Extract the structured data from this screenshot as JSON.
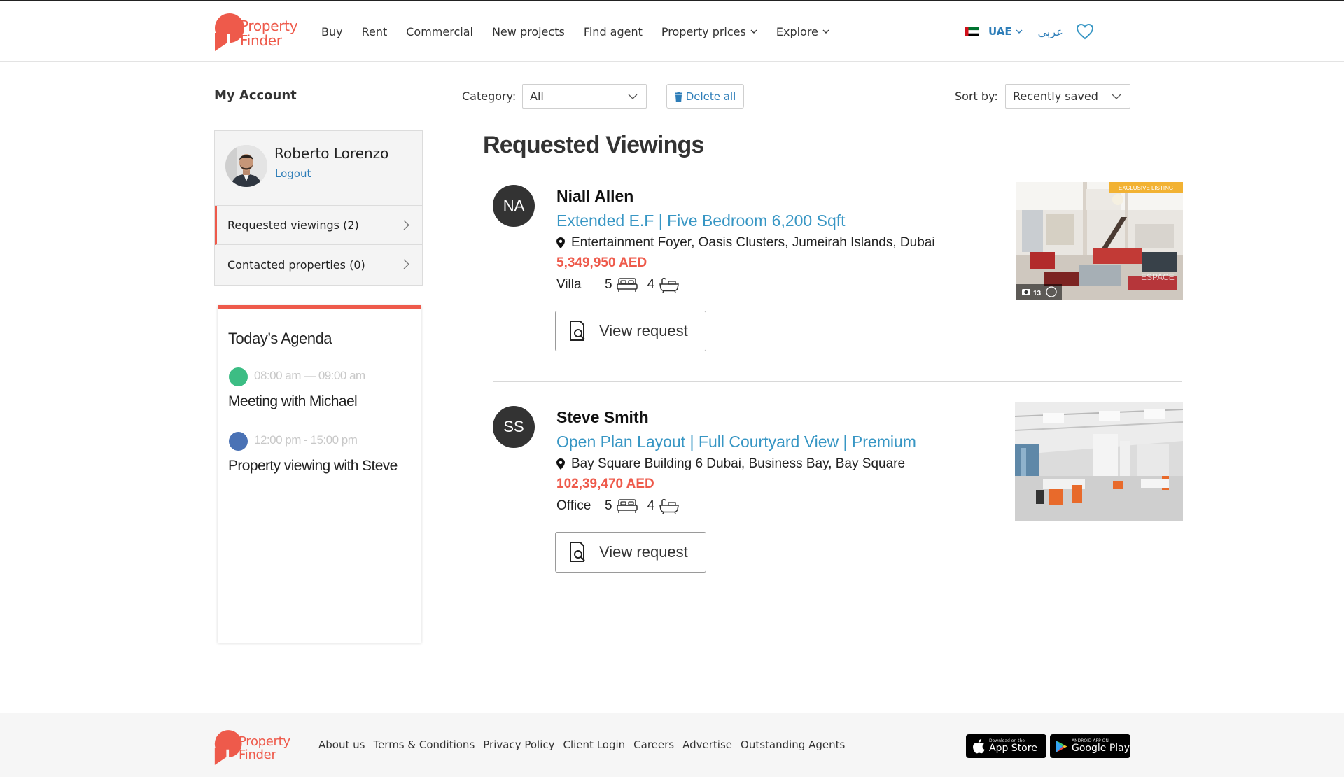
{
  "brand": {
    "name_line1": "Property",
    "name_line2": "Finder",
    "color": "#ee5a4b"
  },
  "nav": {
    "items": [
      "Buy",
      "Rent",
      "Commercial",
      "New projects",
      "Find agent",
      "Property prices",
      "Explore"
    ],
    "country": "UAE",
    "language": "عربي"
  },
  "toolbar": {
    "account_heading": "My Account",
    "category_label": "Category:",
    "category_value": "All",
    "delete_label": "Delete all",
    "sort_label": "Sort by:",
    "sort_value": "Recently saved"
  },
  "profile": {
    "name": "Roberto Lorenzo",
    "logout": "Logout",
    "menu": [
      {
        "label": "Requested viewings (2)",
        "active": true
      },
      {
        "label": "Contacted properties (0)",
        "active": false
      }
    ]
  },
  "agenda": {
    "title": "Today’s Agenda",
    "events": [
      {
        "time": "08:00 am — 09:00 am",
        "title": "Meeting with Michael",
        "color": "#3cbd84"
      },
      {
        "time": "12:00 pm - 15:00 pm",
        "title": "Property viewing with Steve",
        "color": "#4a72b5"
      }
    ]
  },
  "main": {
    "title": "Requested Viewings",
    "listings": [
      {
        "initials": "NA",
        "agent": "Niall Allen",
        "title": "Extended E.F | Five Bedroom 6,200 Sqft",
        "location": "Entertainment Foyer, Oasis Clusters, Jumeirah Islands, Dubai",
        "price": "5,349,950 AED",
        "type": "Villa",
        "beds": "5",
        "baths": "4",
        "button": "View request",
        "badge": "EXCLUSIVE LISTING",
        "photo_count": "13",
        "watermark": "ESPACE"
      },
      {
        "initials": "SS",
        "agent": "Steve Smith",
        "title": "Open Plan Layout | Full Courtyard View | Premium",
        "location": "Bay Square Building 6 Dubai, Business Bay, Bay Square",
        "price": "102,39,470 AED",
        "type": "Office",
        "beds": "5",
        "baths": "4",
        "button": "View request"
      }
    ]
  },
  "footer": {
    "links": [
      "About us",
      "Terms & Conditions",
      "Privacy Policy",
      "Client Login",
      "Careers",
      "Advertise",
      "Outstanding Agents"
    ],
    "appstore_small": "Download on the",
    "appstore_big": "App Store",
    "googleplay_small": "ANDROID APP ON",
    "googleplay_big": "Google Play"
  },
  "icons": {
    "nav_chevron": "chevron-down-icon",
    "favorites": "heart-icon",
    "delete": "trash-icon",
    "location": "pin-icon",
    "beds": "bed-icon",
    "baths": "bath-icon",
    "view": "document-search-icon"
  }
}
